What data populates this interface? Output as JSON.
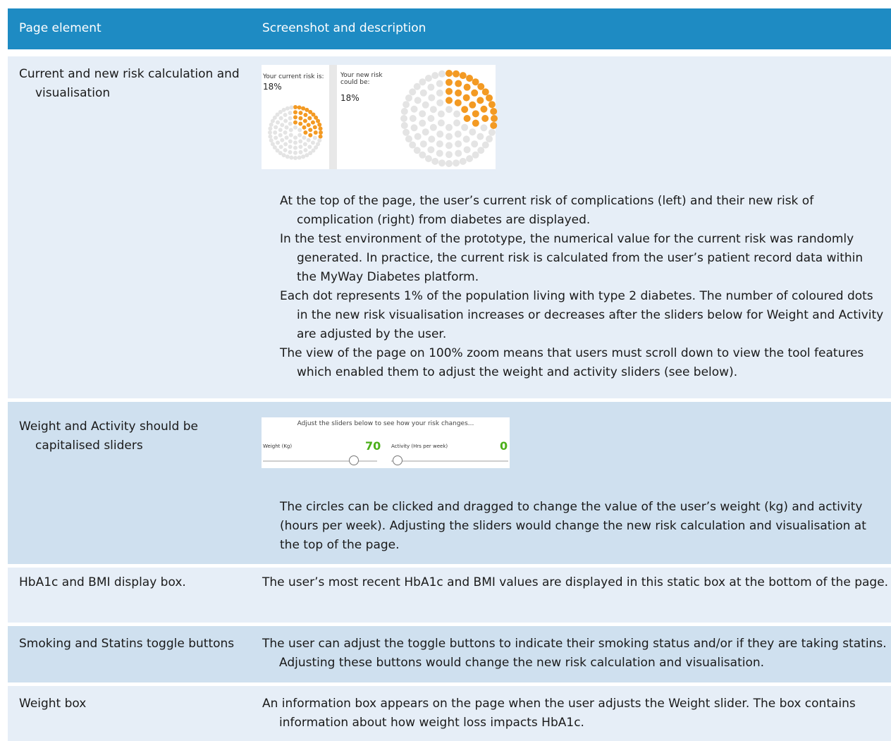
{
  "header": {
    "col1": "Page element",
    "col2": "Screenshot and description"
  },
  "rows": [
    {
      "label": "Current and new risk calculation and visualisation",
      "screenshot": {
        "current_label": "Your current risk is:",
        "current_value": "18%",
        "new_label": "Your new risk could be:",
        "new_value": "18%",
        "dots_total": 100,
        "dots_highlighted_fraction": 0.18,
        "highlight_color": "#f39a23",
        "dot_color": "#e4e4e4"
      },
      "paragraphs": [
        "At the top of the page, the user’s current risk of complications (left) and their new risk of complication (right) from diabetes are displayed.",
        "In the test environment of the prototype, the numerical value for the current risk was randomly generated. In practice, the current risk is calculated from the user’s patient record data within the MyWay Diabetes platform.",
        "Each dot represents 1% of the population living with type 2 diabetes. The number of coloured dots in the new risk visualisation increases or decreases after the sliders below for Weight and Activity are adjusted by the user.",
        "The view of the page on 100% zoom means that users must scroll down to view the tool features which enabled them to adjust the weight and activity sliders (see below)."
      ]
    },
    {
      "label": "Weight and Activity should be capitalised sliders",
      "screenshot": {
        "title": "Adjust the sliders below to see how your risk changes...",
        "weight_label": "Weight (Kg)",
        "weight_value": "70",
        "activity_label": "Activity (Hrs per week)",
        "activity_value": "0",
        "value_color": "#4caf1a"
      },
      "paragraphs": [
        "The circles can be clicked and dragged to change the value of the user’s weight (kg) and activity (hours per week). Adjusting the sliders would change the new risk calculation and visualisation at the top of the page."
      ]
    },
    {
      "label": "HbA1c and BMI display box.",
      "paragraphs": [
        "The user’s most recent HbA1c and BMI values are displayed in this static box at the bottom of the page."
      ]
    },
    {
      "label": "Smoking and Statins toggle buttons",
      "paragraphs": [
        "The user can adjust the toggle buttons to indicate their smoking status and/or if they are taking statins. Adjusting these buttons would change the new risk calculation and visualisation."
      ]
    },
    {
      "label": "Weight box",
      "paragraphs": [
        "An information box appears on the page when the user adjusts the Weight slider. The box contains information about how weight loss impacts HbA1c."
      ]
    }
  ],
  "colors": {
    "header_bg": "#1e8bc3",
    "row_light": "#e6eef7",
    "row_dark": "#cfe0ef"
  }
}
